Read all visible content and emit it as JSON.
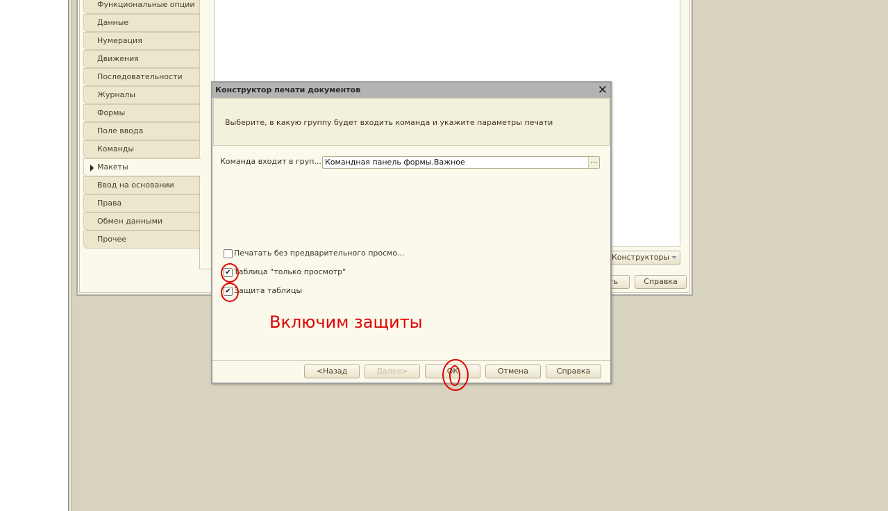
{
  "sidebar": {
    "items": [
      {
        "label": "Функциональные опции"
      },
      {
        "label": "Данные"
      },
      {
        "label": "Нумерация"
      },
      {
        "label": "Движения"
      },
      {
        "label": "Последовательности"
      },
      {
        "label": "Журналы"
      },
      {
        "label": "Формы"
      },
      {
        "label": "Поле ввода"
      },
      {
        "label": "Команды"
      },
      {
        "label": "Макеты",
        "active": true
      },
      {
        "label": "Ввод на основании"
      },
      {
        "label": "Права"
      },
      {
        "label": "Обмен данными"
      },
      {
        "label": "Прочее"
      }
    ]
  },
  "background_window": {
    "constructors_button": "Конструкторы",
    "partial_button": "ть",
    "help_button": "Справка"
  },
  "dialog": {
    "title": "Конструктор печати документов",
    "instruction": "Выберите, в какую группу будет входить команда и укажите параметры печати",
    "group_label": "Команда входит в груп...",
    "group_value": "Командная панель формы.Важное",
    "select_button": "...",
    "checkboxes": [
      {
        "label": "Печатать без предварительного просмо...",
        "checked": false
      },
      {
        "label": "Таблица \"только просмотр\"",
        "checked": true
      },
      {
        "label": "Защита таблицы",
        "checked": true
      }
    ],
    "buttons": {
      "back": "<Назад",
      "next": "Далее>",
      "ok": "ОК",
      "cancel": "Отмена",
      "help": "Справка"
    }
  },
  "annotation": {
    "text": "Включим защиты",
    "color": "#e00000"
  }
}
